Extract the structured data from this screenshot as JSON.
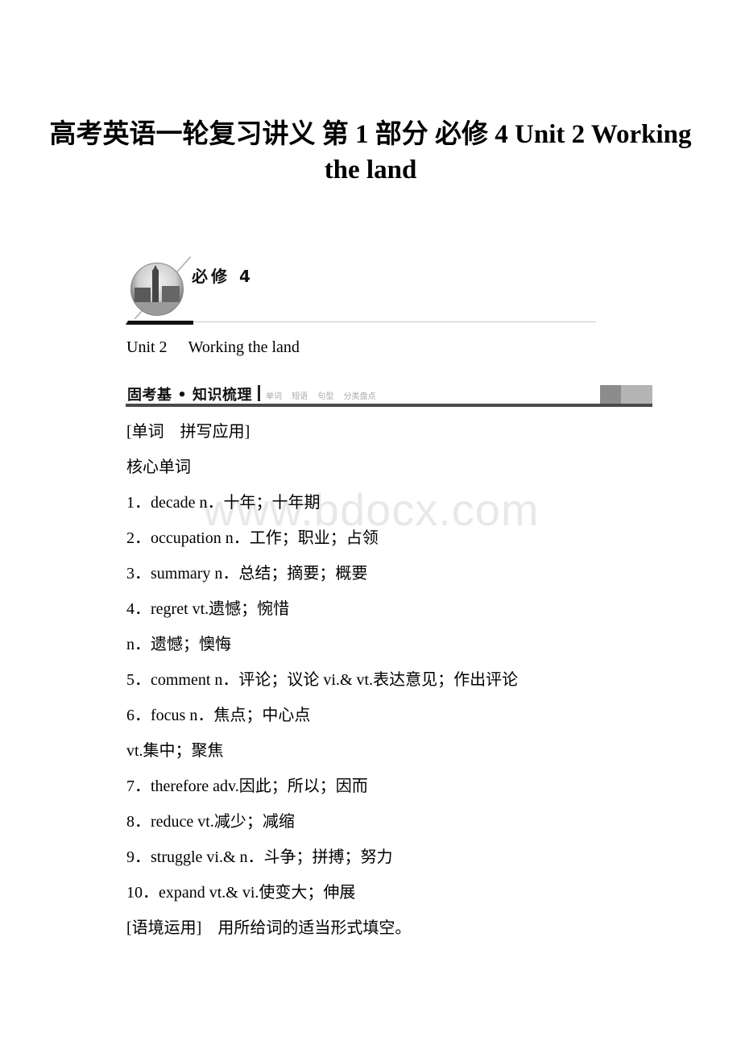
{
  "document": {
    "title": "高考英语一轮复习讲义 第 1 部分 必修 4 Unit 2 Working the land"
  },
  "banner": {
    "book_label": "必修 4",
    "image_icon": "big-ben-globe-icon"
  },
  "unit": {
    "number": "Unit 2",
    "name": "Working the land"
  },
  "section_header": {
    "title": "固考基 • 知识梳理",
    "subtitles": [
      "单词",
      "短语",
      "句型",
      "分类盘点"
    ]
  },
  "content": {
    "lines": [
      "[单词　拼写应用]",
      "核心单词",
      "1．decade n．十年；十年期",
      "2．occupation n．工作；职业；占领",
      "3．summary n．总结；摘要；概要",
      "4．regret vt.遗憾；惋惜",
      "n．遗憾；懊悔",
      "5．comment n．评论；议论 vi.& vt.表达意见；作出评论",
      "6．focus n．焦点；中心点",
      "vt.集中；聚焦",
      "7．therefore adv.因此；所以；因而",
      "8．reduce vt.减少；减缩",
      "9．struggle vi.& n．斗争；拼搏；努力",
      "10．expand vt.& vi.使变大；伸展",
      "[语境运用]　用所给词的适当形式填空。"
    ]
  },
  "watermark": "www.bdocx.com"
}
